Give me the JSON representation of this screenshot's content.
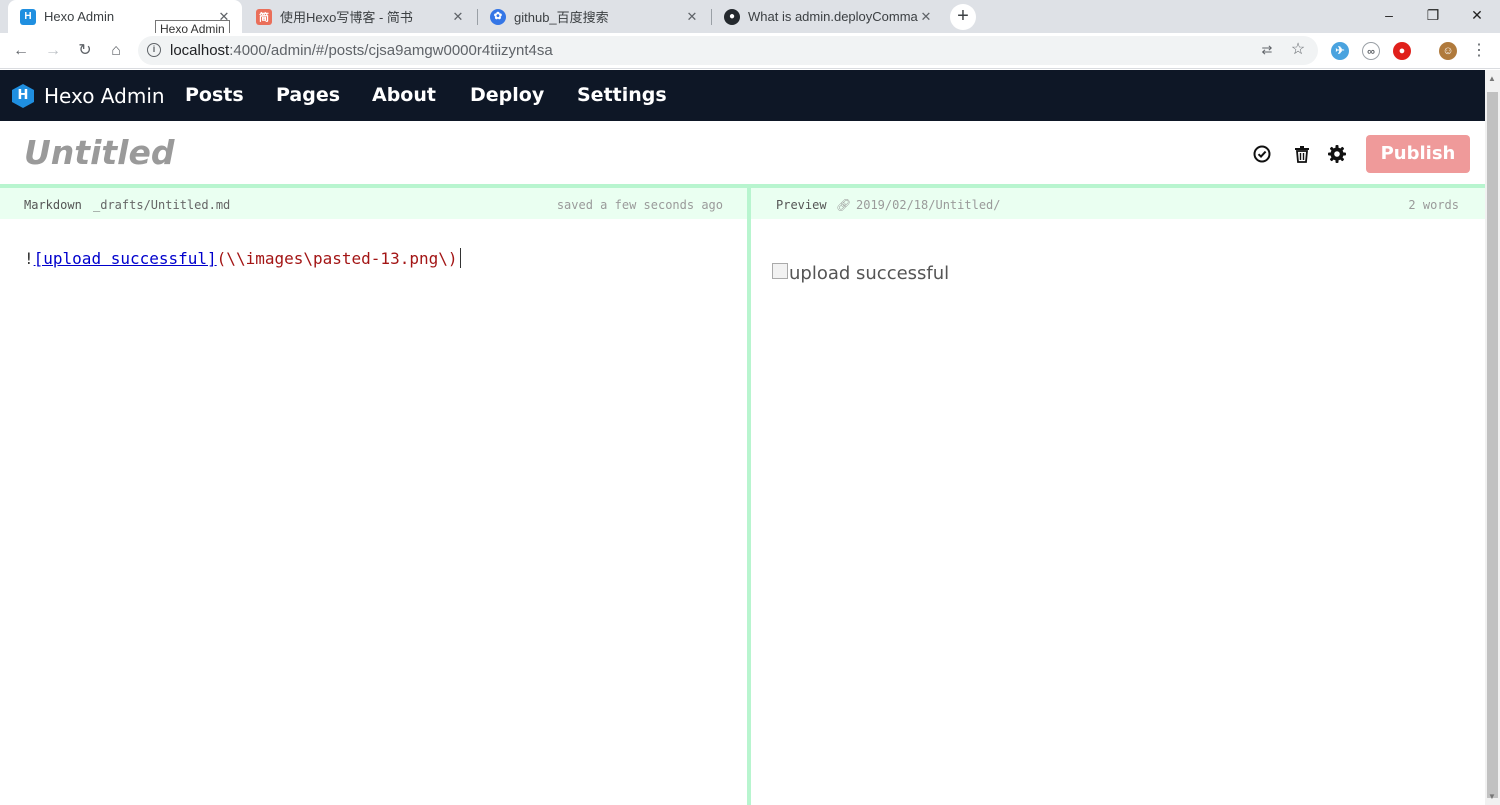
{
  "browser": {
    "tabs": [
      {
        "title": "Hexo Admin",
        "favicon": "hexo-icon",
        "active": true
      },
      {
        "title": "使用Hexo写博客 - 简书",
        "favicon": "jianshu-icon",
        "favicon_char": "简"
      },
      {
        "title": "github_百度搜索",
        "favicon": "baidu-paw-icon"
      },
      {
        "title": "What is admin.deployComman",
        "favicon": "github-icon"
      }
    ],
    "tooltip": "Hexo Admin",
    "url_host": "localhost",
    "url_rest": ":4000/admin/#/posts/cjsa9amgw0000r4tiizynt4sa",
    "window_controls": {
      "minimize": "–",
      "restore": "❐",
      "close": "✕"
    }
  },
  "app": {
    "brand": "Hexo Admin",
    "nav": [
      "Posts",
      "Pages",
      "About",
      "Deploy",
      "Settings"
    ]
  },
  "editor": {
    "title": "Untitled",
    "publish_label": "Publish",
    "left_header": {
      "mode": "Markdown",
      "path": "_drafts/Untitled.md",
      "status": "saved a few seconds ago"
    },
    "right_header": {
      "mode": "Preview",
      "permalink": "2019/02/18/Untitled/",
      "word_count": "2 words"
    },
    "markdown": {
      "prefix": "!",
      "link_text": "[upload successful]",
      "link_url": "(\\\\images\\pasted-13.png\\)"
    },
    "preview_alt": "upload successful"
  },
  "colors": {
    "nav_bg": "#0e1726",
    "publish_bg": "#ef9a9a",
    "accent_green": "#b8f5cf"
  }
}
